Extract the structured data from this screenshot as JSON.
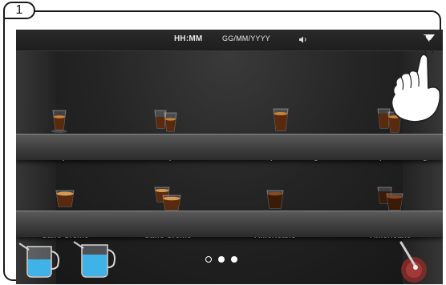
{
  "step_number": "1",
  "status_bar": {
    "time": "HH:MM",
    "date": "GG/MM/YYYY"
  },
  "drinks_row1": [
    {
      "label": "Caffè Espresso",
      "icon": "single-espresso-cup-icon"
    },
    {
      "label": "Caffè Espresso",
      "icon": "double-espresso-cup-icon"
    },
    {
      "label": "Caffè Espresso Lungo",
      "icon": "single-lungo-cup-icon"
    },
    {
      "label": "Caffè Espresso Lungo",
      "icon": "double-lungo-cup-icon"
    }
  ],
  "drinks_row2": [
    {
      "label": "Caffè Creme",
      "icon": "single-creme-cup-icon"
    },
    {
      "label": "Caffè Creme",
      "icon": "double-creme-cup-icon"
    },
    {
      "label": "Americano",
      "icon": "single-americano-cup-icon"
    },
    {
      "label": "Americano",
      "icon": "double-americano-cup-icon"
    }
  ],
  "pager": {
    "pages": 3,
    "current": 2
  },
  "colors": {
    "screen_bg": "#1b1b1b",
    "label": "#f2f2f2",
    "coffee": "#5a2a0e",
    "crema": "#c8853a",
    "water": "#3fb3e8"
  }
}
